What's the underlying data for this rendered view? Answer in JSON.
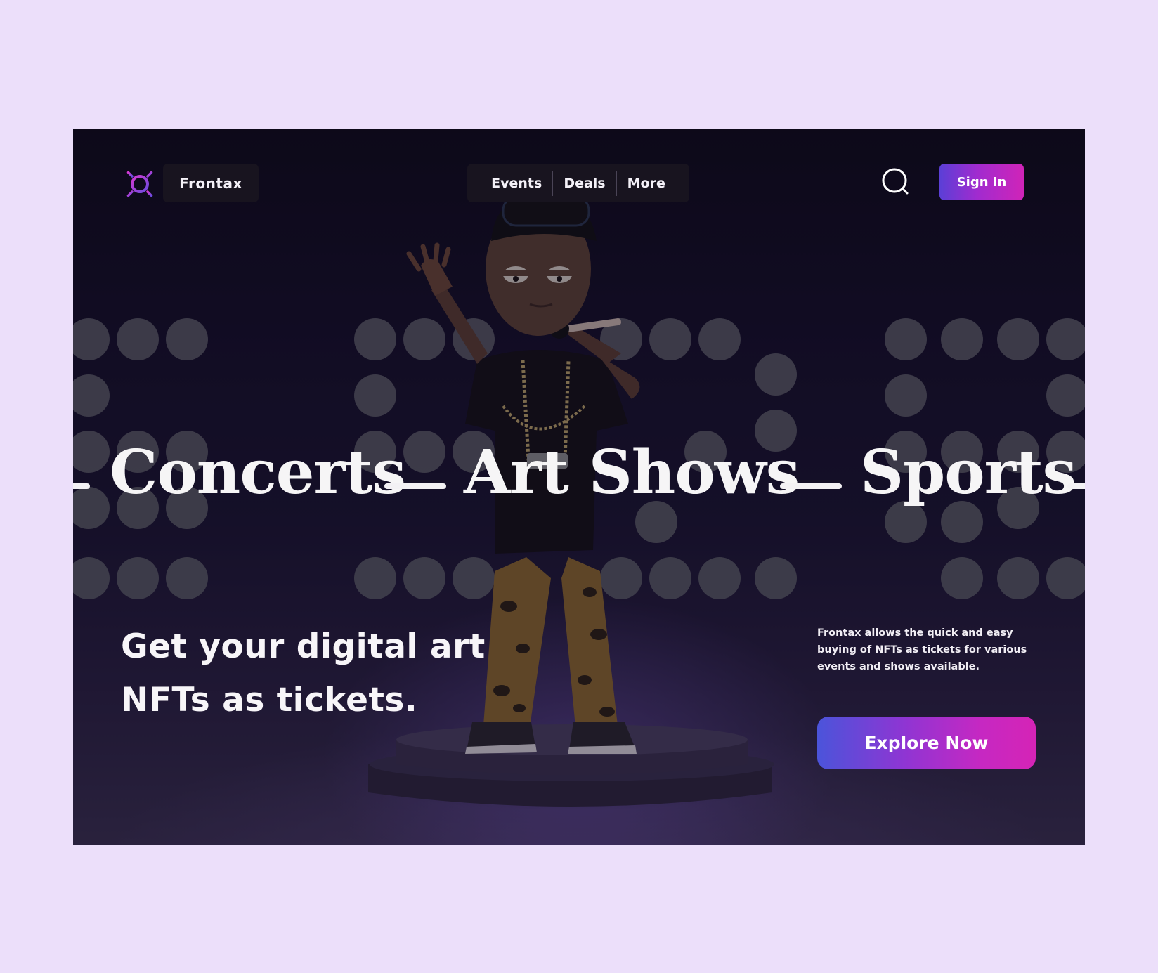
{
  "nav": {
    "brand": "Frontax",
    "links": [
      "Events",
      "Deals",
      "More"
    ],
    "signin_label": "Sign In",
    "search_icon": "search-icon",
    "logo_icon": "sun-logo-icon"
  },
  "marquee": {
    "items": [
      "Concerts",
      "Art Shows",
      "Sports"
    ]
  },
  "hero": {
    "headline": "Get your digital art NFTs as tickets.",
    "description": "Frontax allows the quick and easy buying of NFTs as tickets for various events and shows available.",
    "cta_label": "Explore Now"
  },
  "colors": {
    "page_background": "#ecdffa",
    "accent_start": "#4b54da",
    "accent_end": "#d524b6",
    "pill_background": "#18141f"
  }
}
